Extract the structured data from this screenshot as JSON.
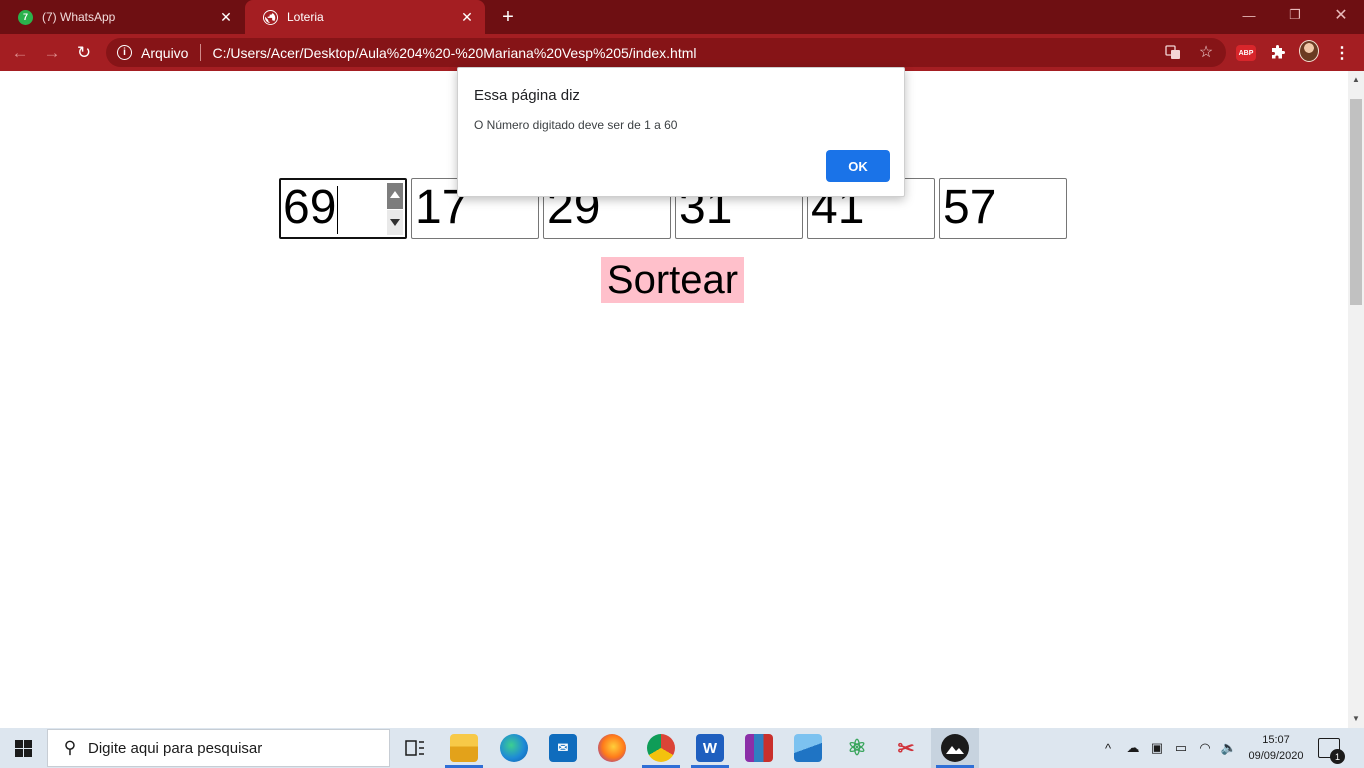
{
  "browser": {
    "tabs": [
      {
        "title": "(7) WhatsApp",
        "badge": "7",
        "active": false
      },
      {
        "title": "Loteria",
        "active": true
      }
    ],
    "address": {
      "scheme_label": "Arquivo",
      "url": "C:/Users/Acer/Desktop/Aula%204%20-%20Mariana%20Vesp%205/index.html"
    },
    "extensions": {
      "abp_label": "ABP"
    },
    "colors": {
      "frame": "#6e0f12",
      "toolbar": "#a41e22",
      "omnibox": "#861417"
    }
  },
  "page": {
    "inputs": [
      {
        "value": "69",
        "focused": true
      },
      {
        "value": "17"
      },
      {
        "value": "29"
      },
      {
        "value": "31"
      },
      {
        "value": "41"
      },
      {
        "value": "57"
      }
    ],
    "button_label": "Sortear",
    "button_color": "#ffc0cb"
  },
  "dialog": {
    "title": "Essa página diz",
    "message": "O Número digitado deve ser de 1 a 60",
    "ok_label": "OK",
    "ok_color": "#1a73e8"
  },
  "taskbar": {
    "search_placeholder": "Digite aqui para pesquisar",
    "apps": [
      "task-view",
      "file-explorer",
      "edge",
      "mail",
      "firefox",
      "chrome",
      "word",
      "winrar",
      "photos",
      "atom",
      "snip-tool",
      "app-active"
    ],
    "word_letter": "W",
    "time": "15:07",
    "date": "09/09/2020",
    "notification_count": "1"
  }
}
